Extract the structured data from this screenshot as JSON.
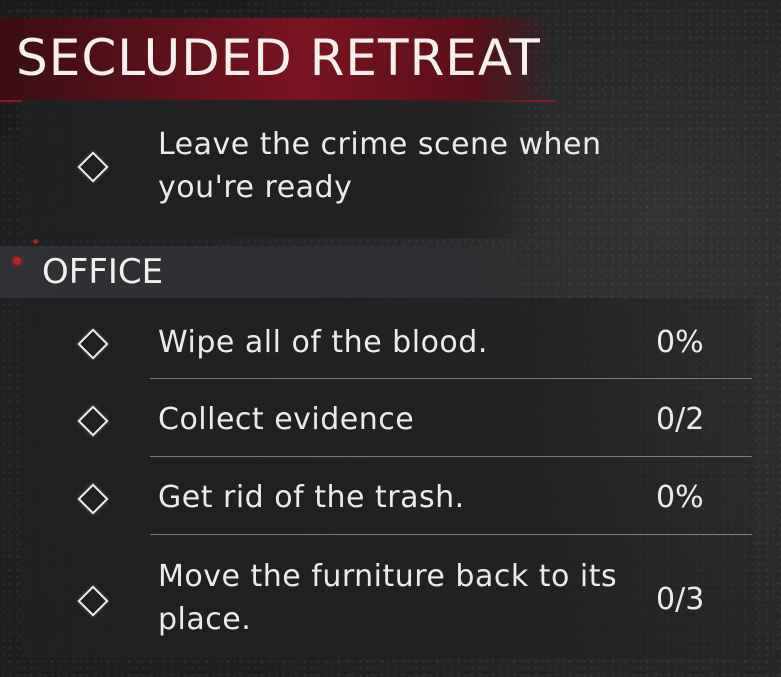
{
  "quest": {
    "title": "SECLUDED RETREAT",
    "main_task": "Leave the crime scene when you're ready",
    "main_task_line1": "Leave the crime scene when",
    "main_task_line2": "you're ready"
  },
  "section": {
    "title": "OFFICE",
    "tasks": [
      {
        "line1": "Wipe all of the blood.",
        "line2": "",
        "progress": "0%"
      },
      {
        "line1": "Collect evidence",
        "line2": "",
        "progress": "0/2"
      },
      {
        "line1": "Get rid of the trash.",
        "line2": "",
        "progress": "0%"
      },
      {
        "line1": "Move the furniture back to its",
        "line2": "place.",
        "progress": "0/3"
      }
    ]
  },
  "icons": {
    "task_marker": "diamond-icon"
  },
  "colors": {
    "title_banner": "#7a1420",
    "accent_red": "#c41b2a",
    "text": "#ecebe9"
  }
}
